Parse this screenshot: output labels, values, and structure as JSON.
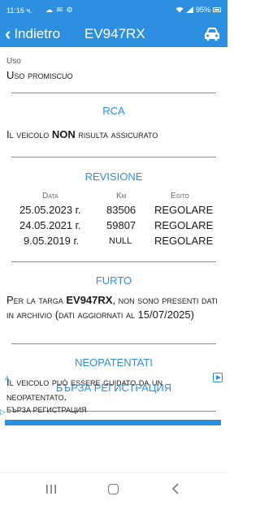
{
  "status_bar": {
    "time": "11:16 ч.",
    "notification_icons": "☁ ✉ ⚙",
    "battery": "95%"
  },
  "app_bar": {
    "back_label": "Indietro",
    "title": "EV947RX"
  },
  "uso": {
    "label": "Uso",
    "value": "Uso promiscuo"
  },
  "rca": {
    "title": "RCA",
    "text_prefix": "Il veicolo ",
    "text_bold": "NON",
    "text_suffix": " risulta assicurato"
  },
  "revisione": {
    "title": "REVISIONE",
    "headers": {
      "data": "Data",
      "km": "Km",
      "esito": "Esito"
    },
    "rows": [
      {
        "data": "25.05.2023 г.",
        "km": "83506",
        "esito": "REGOLARE"
      },
      {
        "data": "24.05.2021 г.",
        "km": "59807",
        "esito": "REGOLARE"
      },
      {
        "data": "9.05.2019 г.",
        "km": "NULL",
        "esito": "REGOLARE"
      }
    ]
  },
  "furto": {
    "title": "FURTO",
    "text_prefix": "Per la targa ",
    "text_bold": "EV947RX",
    "text_suffix": ", non sono presenti dati in archivio (dati aggiornati al 15/07/2025)"
  },
  "neopatentati": {
    "title": "NEOPATENTATI",
    "text": "Il veicolo può essere guidato da un neopatentato."
  },
  "ad": {
    "marker": "A",
    "title": "БЪРЗА РЕГИСТРАЦИЯ",
    "subtitle": "БЪРЗА РЕГИСТРАЦИЯ"
  },
  "colors": {
    "accent": "#2c8fe0",
    "divider": "#8a8a8a"
  },
  "icons": {
    "back": "chevron-left-icon",
    "car": "car-icon",
    "ad_play": "ad-play-icon",
    "nav_recent": "recent-apps-icon",
    "nav_home": "home-icon",
    "nav_back": "back-icon"
  }
}
